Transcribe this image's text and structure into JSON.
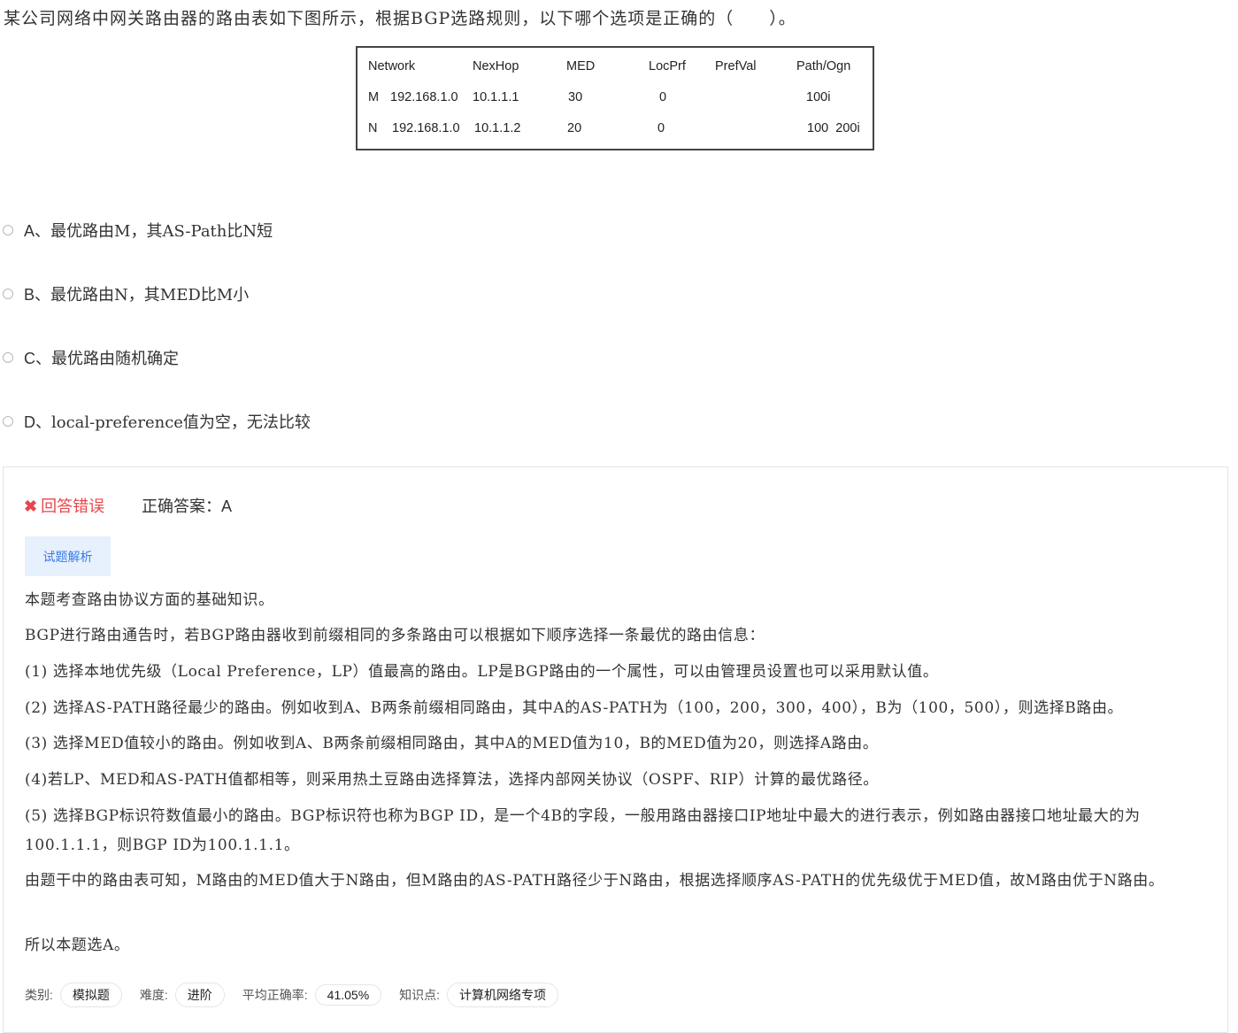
{
  "question": "某公司网络中网关路由器的路由表如下图所示，根据BGP选路规则，以下哪个选项是正确的（　　）。",
  "route_table": {
    "headers": [
      "Network",
      "NexHop",
      "MED",
      "LocPrf",
      "PrefVal",
      "Path/Ogn"
    ],
    "rows": [
      {
        "label": "M",
        "network": "192.168.1.0",
        "nexthop": "10.1.1.1",
        "med": "30",
        "locprf": "0",
        "prefval": "",
        "path": "100i"
      },
      {
        "label": "N",
        "network": "192.168.1.0",
        "nexthop": "10.1.1.2",
        "med": "20",
        "locprf": "0",
        "prefval": "",
        "path": "100  200i"
      }
    ]
  },
  "options": [
    {
      "letter": "A、",
      "text": "最优路由M，其AS-Path比N短"
    },
    {
      "letter": "B、",
      "text": "最优路由N，其MED比M小"
    },
    {
      "letter": "C、",
      "text": "最优路由随机确定"
    },
    {
      "letter": "D、",
      "text": "local-preference值为空，无法比较"
    }
  ],
  "result": {
    "status_icon": "✖",
    "status_text": "回答错误",
    "answer_label": "正确答案：",
    "answer_value": "A"
  },
  "explanation_tab": "试题解析",
  "explanation": [
    "本题考查路由协议方面的基础知识。",
    "BGP进行路由通告时，若BGP路由器收到前缀相同的多条路由可以根据如下顺序选择一条最优的路由信息：",
    "(1) 选择本地优先级（Local Preference，LP）值最高的路由。LP是BGP路由的一个属性，可以由管理员设置也可以采用默认值。",
    "(2) 选择AS-PATH路径最少的路由。例如收到A、B两条前缀相同路由，其中A的AS-PATH为（100，200，300，400），B为（100，500），则选择B路由。",
    "(3) 选择MED值较小的路由。例如收到A、B两条前缀相同路由，其中A的MED值为10，B的MED值为20，则选择A路由。",
    "(4)若LP、MED和AS-PATH值都相等，则采用热土豆路由选择算法，选择内部网关协议（OSPF、RIP）计算的最优路径。",
    "(5) 选择BGP标识符数值最小的路由。BGP标识符也称为BGP ID，是一个4B的字段，一般用路由器接口IP地址中最大的进行表示，例如路由器接口地址最大的为100.1.1.1，则BGP ID为100.1.1.1。",
    "由题干中的路由表可知，M路由的MED值大于N路由，但M路由的AS-PATH路径少于N路由，根据选择顺序AS-PATH的优先级优于MED值，故M路由优于N路由。",
    "所以本题选A。"
  ],
  "meta": {
    "category_label": "类别:",
    "category_value": "模拟题",
    "difficulty_label": "难度:",
    "difficulty_value": "进阶",
    "accuracy_label": "平均正确率:",
    "accuracy_value": "41.05%",
    "knowledge_label": "知识点:",
    "knowledge_value": "计算机网络专项"
  },
  "colors": {
    "wrong": "#e8464a",
    "tab_bg": "#e7f0fd",
    "tab_text": "#3b7be6"
  }
}
